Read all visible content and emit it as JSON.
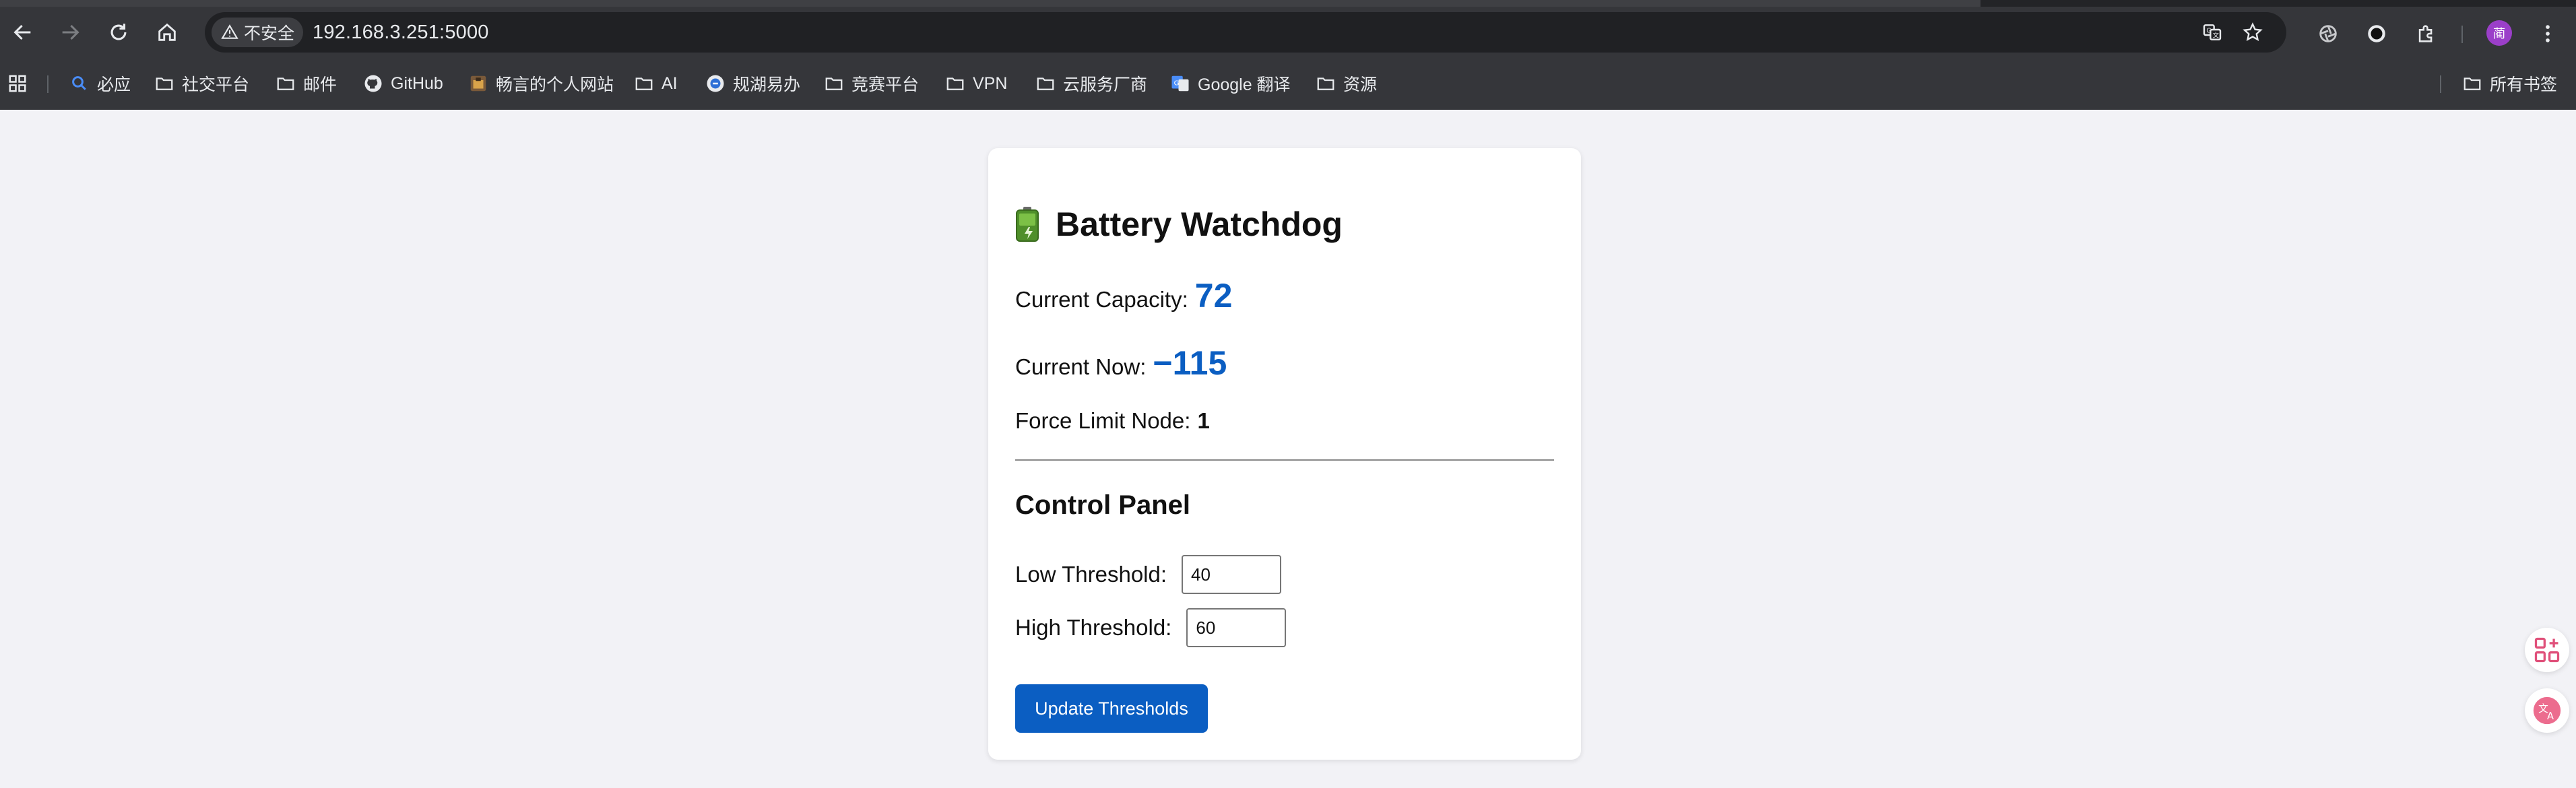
{
  "browser": {
    "security_label": "不安全",
    "url": "192.168.3.251:5000",
    "avatar_letter": "蔺",
    "bookmarks": [
      {
        "label": "必应",
        "icon": "search-icon"
      },
      {
        "label": "社交平台",
        "icon": "folder-icon"
      },
      {
        "label": "邮件",
        "icon": "folder-icon"
      },
      {
        "label": "GitHub",
        "icon": "github-icon"
      },
      {
        "label": "畅言的个人网站",
        "icon": "site-favicon"
      },
      {
        "label": "AI",
        "icon": "folder-icon"
      },
      {
        "label": "规湖易办",
        "icon": "site-favicon"
      },
      {
        "label": "竞赛平台",
        "icon": "folder-icon"
      },
      {
        "label": "VPN",
        "icon": "folder-icon"
      },
      {
        "label": "云服务厂商",
        "icon": "folder-icon"
      },
      {
        "label": "Google 翻译",
        "icon": "google-translate-icon"
      },
      {
        "label": "资源",
        "icon": "folder-icon"
      }
    ],
    "all_bookmarks_label": "所有书签"
  },
  "app": {
    "title": "Battery Watchdog",
    "title_icon": "battery-icon",
    "capacity_label": "Current Capacity:",
    "capacity_value": "72",
    "current_label": "Current Now:",
    "current_value": "−115",
    "force_label": "Force Limit Node:",
    "force_value": "1",
    "control_panel_title": "Control Panel",
    "low_label": "Low Threshold:",
    "low_value": "40",
    "high_label": "High Threshold:",
    "high_value": "60",
    "update_button": "Update Thresholds"
  },
  "colors": {
    "accent": "#0b5ec2",
    "page_background": "#f2f2f6",
    "chrome_background": "#35363a"
  }
}
